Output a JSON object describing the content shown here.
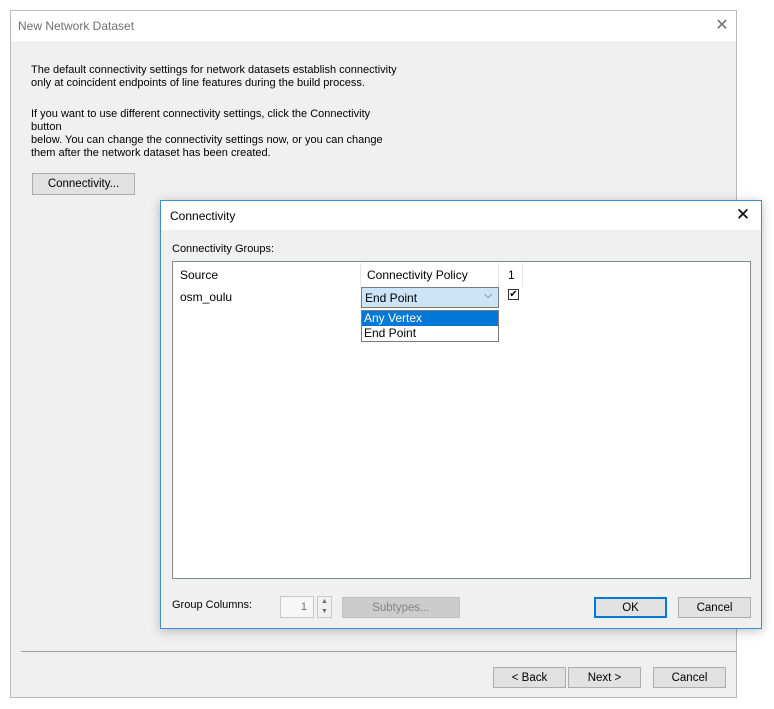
{
  "main_window": {
    "title": "New Network Dataset",
    "intro_line1": "The default connectivity settings for network datasets establish connectivity",
    "intro_line2": "only at coincident endpoints of line features during the build process.",
    "intro_line3": "If you want to use different connectivity settings, click the Connectivity button",
    "intro_line4": "below. You can change the connectivity settings now, or you can change",
    "intro_line5": "them after the network dataset has been created.",
    "connectivity_button": "Connectivity...",
    "back_button": "< Back",
    "next_button": "Next >",
    "cancel_button": "Cancel"
  },
  "dialog": {
    "title": "Connectivity",
    "groups_label": "Connectivity Groups:",
    "columns": [
      "Source",
      "Connectivity Policy",
      "1"
    ],
    "row": {
      "source": "osm_oulu",
      "policy": "End Point",
      "group1_checked": true,
      "check_glyph": "✔"
    },
    "dropdown_options": [
      "Any Vertex",
      "End Point"
    ],
    "highlighted_option": "Any Vertex",
    "group_columns_label": "Group Columns:",
    "group_columns_value": "1",
    "subtypes_button": "Subtypes...",
    "ok_button": "OK",
    "cancel_button": "Cancel"
  },
  "icons": {
    "close": "✕",
    "chevron_down": "⌵",
    "spin_up": "▲",
    "spin_down": "▼"
  }
}
